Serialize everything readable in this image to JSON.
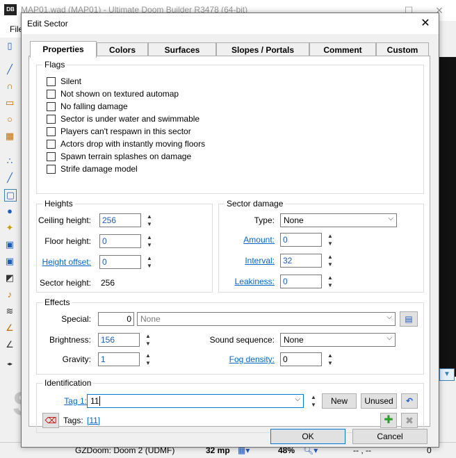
{
  "app": {
    "logo": "DB",
    "title": "MAP01.wad (MAP01) - Ultimate Doom Builder R3478 (64-bit)",
    "menu_file": "File",
    "status": {
      "engine": "GZDoom: Doom 2 (UDMF)",
      "grid": "32 mp",
      "zoom": "48%",
      "coords": "-- , --",
      "zero": "0"
    }
  },
  "dialog": {
    "title": "Edit Sector",
    "tabs": [
      "Properties",
      "Colors",
      "Surfaces",
      "Slopes / Portals",
      "Comment",
      "Custom"
    ],
    "flags": {
      "title": "Flags",
      "items": [
        "Silent",
        "Not shown on textured automap",
        "No falling damage",
        "Sector is under water and swimmable",
        "Players can't respawn in this sector",
        "Actors drop with instantly moving floors",
        "Spawn terrain splashes on damage",
        "Strife damage model"
      ]
    },
    "heights": {
      "title": "Heights",
      "ceiling_label": "Ceiling height:",
      "ceiling_value": "256",
      "floor_label": "Floor height:",
      "floor_value": "0",
      "offset_label": "Height offset:",
      "offset_value": "0",
      "sector_label": "Sector height:",
      "sector_value": "256"
    },
    "damage": {
      "title": "Sector damage",
      "type_label": "Type:",
      "type_value": "None",
      "amount_label": "Amount:",
      "amount_value": "0",
      "interval_label": "Interval:",
      "interval_value": "32",
      "leakiness_label": "Leakiness:",
      "leakiness_value": "0"
    },
    "effects": {
      "title": "Effects",
      "special_label": "Special:",
      "special_value": "0",
      "special_name": "None",
      "brightness_label": "Brightness:",
      "brightness_value": "156",
      "gravity_label": "Gravity:",
      "gravity_value": "1",
      "sound_label": "Sound sequence:",
      "sound_value": "None",
      "fog_label": "Fog density:",
      "fog_value": "0"
    },
    "identification": {
      "title": "Identification",
      "tag_label": "Tag 1:",
      "tag_value": "11",
      "new_label": "New",
      "unused_label": "Unused",
      "tags_label": "Tags:",
      "tags_value": "[11]"
    },
    "ok_label": "OK",
    "cancel_label": "Cancel"
  }
}
